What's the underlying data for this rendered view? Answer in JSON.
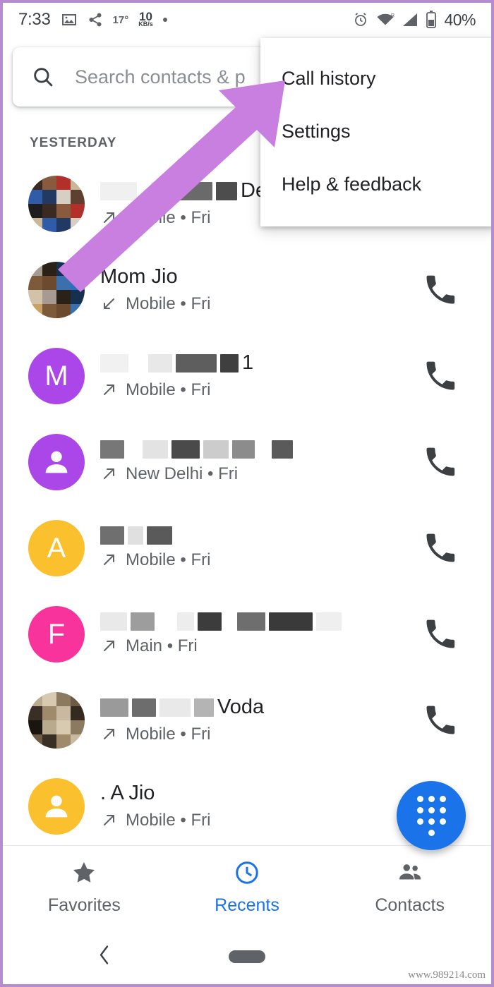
{
  "status_bar": {
    "time": "7:33",
    "temperature": "17°",
    "net_speed_value": "10",
    "net_speed_unit": "KB/s",
    "battery_percent": "40%",
    "icons": [
      "image-icon",
      "share-icon",
      "alarm-icon",
      "wifi-icon",
      "signal-icon",
      "battery-icon"
    ]
  },
  "search": {
    "placeholder": "Search contacts & p",
    "icon": "search-icon"
  },
  "overflow_menu": {
    "items": [
      {
        "label": "Call history"
      },
      {
        "label": "Settings"
      },
      {
        "label": "Help & feedback"
      }
    ]
  },
  "call_list": {
    "section_header": "YESTERDAY",
    "rows": [
      {
        "name_visible": "Delhi",
        "name_redacted": true,
        "avatar_type": "photo",
        "avatar_letter": "",
        "avatar_color": "#7a6a5d",
        "direction": "outgoing",
        "subtitle": "Mobile • Fri",
        "call_button": "call-icon"
      },
      {
        "name_visible": "Mom Jio",
        "name_redacted": false,
        "avatar_type": "photo",
        "avatar_letter": "",
        "avatar_color": "#c8a165",
        "direction": "incoming",
        "subtitle": "Mobile • Fri",
        "call_button": "call-icon"
      },
      {
        "name_visible": "1",
        "name_redacted": true,
        "avatar_type": "letter",
        "avatar_letter": "M",
        "avatar_color": "#ab47e8",
        "direction": "outgoing",
        "subtitle": "Mobile • Fri",
        "call_button": "call-icon"
      },
      {
        "name_visible": "",
        "name_redacted": true,
        "avatar_type": "person",
        "avatar_letter": "",
        "avatar_color": "#ab47e8",
        "direction": "outgoing",
        "subtitle": "New Delhi • Fri",
        "call_button": "call-icon"
      },
      {
        "name_visible": "",
        "name_redacted": true,
        "avatar_type": "letter",
        "avatar_letter": "A",
        "avatar_color": "#fbc02d",
        "direction": "outgoing",
        "subtitle": "Mobile • Fri",
        "call_button": "call-icon"
      },
      {
        "name_visible": "",
        "name_redacted": true,
        "avatar_type": "letter",
        "avatar_letter": "F",
        "avatar_color": "#f8339b",
        "direction": "outgoing",
        "subtitle": "Main • Fri",
        "call_button": "call-icon"
      },
      {
        "name_visible": "Voda",
        "name_redacted": true,
        "avatar_type": "photo",
        "avatar_letter": "",
        "avatar_color": "#b9a98d",
        "direction": "outgoing",
        "subtitle": "Mobile • Fri",
        "call_button": "call-icon"
      },
      {
        "name_visible": ". A Jio",
        "name_redacted": false,
        "avatar_type": "person",
        "avatar_letter": "",
        "avatar_color": "#fbc02d",
        "direction": "outgoing",
        "subtitle": "Mobile • Fri",
        "call_button": "call-icon"
      }
    ]
  },
  "fab": {
    "icon": "dialpad-icon",
    "color": "#1a73e8"
  },
  "bottom_tabs": {
    "active": "Recents",
    "accent_color": "#1a73e8",
    "items": [
      {
        "label": "Favorites",
        "icon": "star-icon"
      },
      {
        "label": "Recents",
        "icon": "clock-icon"
      },
      {
        "label": "Contacts",
        "icon": "people-icon"
      }
    ]
  },
  "system_nav": {
    "back": "back-chevron-icon",
    "home": "home-pill-icon"
  },
  "watermark": "www.989214.com",
  "annotation": {
    "arrow_color": "#c97fe0",
    "description": "arrow pointing to Call history"
  }
}
